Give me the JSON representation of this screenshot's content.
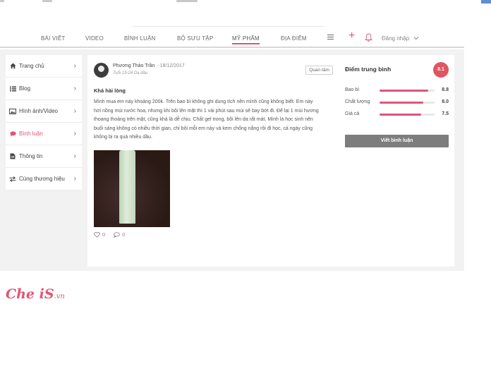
{
  "nav": {
    "items": [
      {
        "label": "BÀI VIẾT",
        "active": false
      },
      {
        "label": "VIDEO",
        "active": false
      },
      {
        "label": "BÌNH LUẬN",
        "active": false
      },
      {
        "label": "BỘ SƯU TẬP",
        "active": false
      },
      {
        "label": "MỸ PHẨM",
        "active": true
      },
      {
        "label": "ĐỊA ĐIỂM",
        "active": false
      }
    ],
    "menu_icon": "hamburger-icon",
    "add_icon": "plus-icon",
    "notify_icon": "bell-icon",
    "login_label": "Đăng nhập",
    "login_icon": "chevron-down-icon"
  },
  "sidebar": {
    "items": [
      {
        "label": "Trang chủ",
        "icon": "home-icon",
        "active": false
      },
      {
        "label": "Blog",
        "icon": "list-icon",
        "active": false
      },
      {
        "label": "Hình ảnh/Video",
        "icon": "image-icon",
        "active": false
      },
      {
        "label": "Bình luận",
        "icon": "comment-icon",
        "active": true
      },
      {
        "label": "Thông tin",
        "icon": "document-icon",
        "active": false
      },
      {
        "label": "Cùng thương hiệu",
        "icon": "swap-icon",
        "active": false
      }
    ]
  },
  "review": {
    "author": "Phương Thảo Trần",
    "date": "- 18/12/2017",
    "meta": "Tuổi 19-24  Da dầu",
    "follow_label": "Quan tâm",
    "title": "Khá hài lòng",
    "body": "Mình mua em này khoảng 200k. Trên bao bì không ghi dung tích nên mình cũng không biết. Em này hơi nồng mùi nước hoa, nhưng khi bôi lên mặt thì 1 vài phút sau mùi sẽ bay bớt đi. Để lại 1 mùi hương thoang thoảng trên mặt, cũng khá là dễ chịu. Chất gel trong, bôi lên da rất mát. Mình là học sinh nên buổi sáng không có nhiều thời gian, chỉ bôi mỗi em này và kem chống nắng rồi đi học, cả ngày cũng không bị ra quá nhiều dầu.",
    "likes": "0",
    "comments": "0"
  },
  "rating": {
    "title": "Điểm trung bình",
    "average": "8.1",
    "criteria": [
      {
        "label": "Bao bì",
        "value": "8.8",
        "fraction": 0.88
      },
      {
        "label": "Chất lượng",
        "value": "8.0",
        "fraction": 0.8
      },
      {
        "label": "Giá cả",
        "value": "7.5",
        "fraction": 0.75
      }
    ],
    "write_label": "Viết bình luận"
  },
  "brand": {
    "logo_main": "Che iS",
    "logo_suffix": ".vn",
    "accent": "#e05576",
    "badge_color": "#e05560",
    "button_color": "#7d7d7d"
  }
}
